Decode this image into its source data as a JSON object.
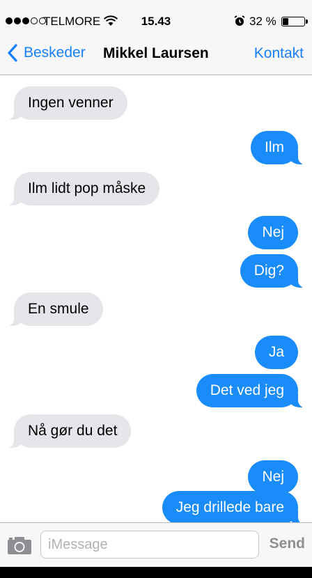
{
  "status_bar": {
    "carrier": "TELMORE",
    "time": "15.43",
    "battery_text": "32 %",
    "battery_level": 0.32,
    "signal_bars_filled": 3,
    "signal_bars_total": 5
  },
  "nav": {
    "back_label": "Beskeder",
    "title": "Mikkel Laursen",
    "contact_label": "Kontakt"
  },
  "messages": [
    {
      "direction": "in",
      "text": "Ingen venner"
    },
    {
      "direction": "out",
      "text": "Ilm"
    },
    {
      "direction": "in",
      "text": "Ilm lidt pop måske"
    },
    {
      "direction": "out",
      "text": "Nej"
    },
    {
      "direction": "out",
      "text": "Dig?"
    },
    {
      "direction": "in",
      "text": "En smule"
    },
    {
      "direction": "out",
      "text": "Ja"
    },
    {
      "direction": "out",
      "text": "Det ved jeg"
    },
    {
      "direction": "in",
      "text": "Nå gør du det"
    },
    {
      "direction": "out",
      "text": "Nej"
    },
    {
      "direction": "out",
      "text": "Jeg drillede bare"
    }
  ],
  "input": {
    "placeholder": "iMessage",
    "value": "",
    "send_label": "Send"
  },
  "colors": {
    "accent": "#1a7ffb",
    "outgoing_bubble": "#1a8cfa",
    "incoming_bubble": "#e5e5ea"
  }
}
